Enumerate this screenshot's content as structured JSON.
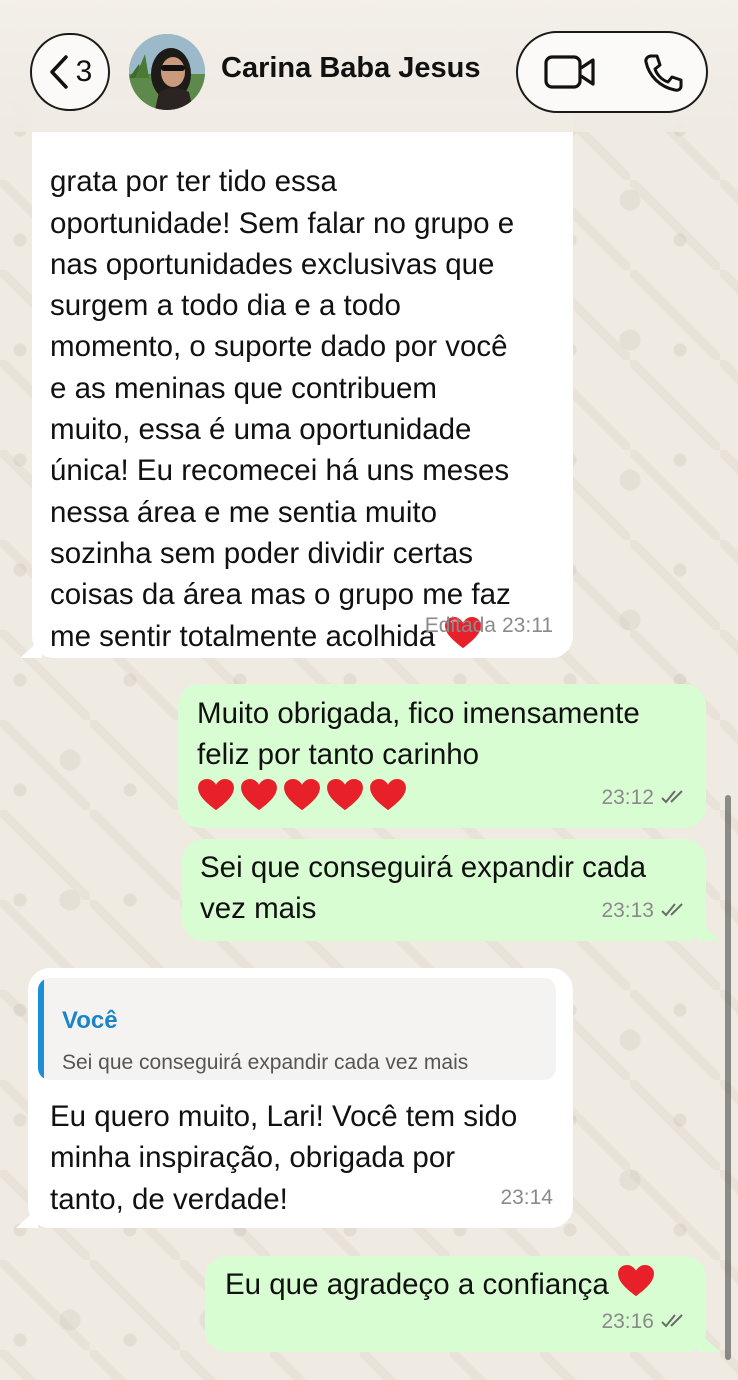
{
  "header": {
    "back_count": "3",
    "contact_name": "Carina Baba Jesus",
    "icons": {
      "back": "chevron-left-icon",
      "video": "video-call-icon",
      "phone": "phone-call-icon"
    }
  },
  "messages": [
    {
      "direction": "incoming",
      "text": "grata por ter tido essa\noportunidade! Sem falar no grupo e\nnas oportunidades exclusivas que\nsurgem a todo dia e a todo\nmomento, o suporte dado por você\ne as meninas que contribuem\nmuito, essa é uma oportunidade\núnica! Eu recomecei há uns meses\nnessa área e me sentia muito\nsozinha sem poder dividir certas\ncoisas da área mas o grupo me faz\nme sentir totalmente acolhida",
      "emoji": "heart",
      "status": "Editada",
      "time": "23:11"
    },
    {
      "direction": "outgoing",
      "text": "Muito obrigada, fico imensamente\nfeliz por tanto carinho",
      "emoji_count": 5,
      "time": "23:12",
      "read": true
    },
    {
      "direction": "outgoing",
      "text": "Sei que conseguirá expandir cada\nvez mais",
      "time": "23:13",
      "read": true
    },
    {
      "direction": "incoming",
      "quote": {
        "author": "Você",
        "text": "Sei que conseguirá expandir cada vez mais"
      },
      "text": "Eu quero muito, Lari! Você tem sido\nminha inspiração, obrigada por\ntanto, de verdade!",
      "time": "23:14"
    },
    {
      "direction": "outgoing",
      "text": "Eu que agradeço a confiança",
      "emoji": "heart",
      "time": "23:16",
      "read": true
    }
  ],
  "colors": {
    "chat_background": "#efeae2",
    "incoming_bubble": "#ffffff",
    "outgoing_bubble": "#d9fdd3",
    "quote_accent": "#1a8fd6",
    "heart": "#e8202a"
  }
}
